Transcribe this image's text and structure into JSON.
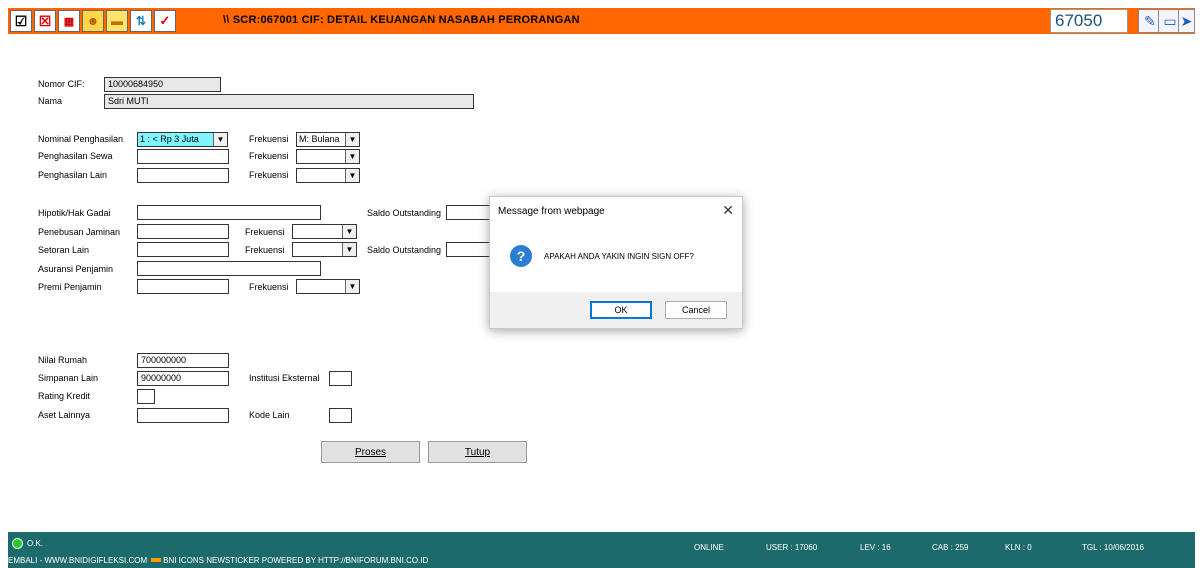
{
  "header": {
    "title": "\\\\ SCR:067001 CIF: DETAIL KEUANGAN NASABAH PERORANGAN",
    "code": "67050",
    "icons_left": [
      "checkbox-icon",
      "close-red-icon",
      "calendar-icon",
      "people-icon",
      "card-icon",
      "tree-icon",
      "chart-icon"
    ],
    "icons_right": [
      "pen-icon",
      "window-icon",
      "arrow-icon"
    ]
  },
  "form": {
    "nomor_cif": {
      "label": "Nomor CIF:",
      "value": "10000684950"
    },
    "nama": {
      "label": "Nama",
      "value": "Sdri MUTI"
    },
    "nominal_penghasilan": {
      "label": "Nominal Penghasilan",
      "value": "1 : < Rp 3 Juta"
    },
    "frekuensi_1": {
      "label": "Frekuensi",
      "value": "M: Bulana"
    },
    "penghasilan_sewa": {
      "label": "Penghasilan Sewa",
      "value": ""
    },
    "frekuensi_2": {
      "label": "Frekuensi",
      "value": ""
    },
    "penghasilan_lain": {
      "label": "Penghasilan Lain",
      "value": ""
    },
    "frekuensi_3": {
      "label": "Frekuensi",
      "value": ""
    },
    "hipotik": {
      "label": "Hipotik/Hak Gadai",
      "value": ""
    },
    "saldo_outstanding_1": {
      "label": "Saldo Outstanding",
      "value": ""
    },
    "penebusan_jaminan": {
      "label": "Penebusan Jaminan",
      "value": ""
    },
    "frekuensi_4": {
      "label": "Frekuensi",
      "value": ""
    },
    "setoran_lain": {
      "label": "Setoran Lain",
      "value": ""
    },
    "frekuensi_5": {
      "label": "Frekuensi",
      "value": ""
    },
    "saldo_outstanding_2": {
      "label": "Saldo Outstanding",
      "value": ""
    },
    "asuransi_penjamin": {
      "label": "Asuransi Penjamin",
      "value": ""
    },
    "premi_penjamin": {
      "label": "Premi Penjamin",
      "value": ""
    },
    "frekuensi_6": {
      "label": "Frekuensi",
      "value": ""
    },
    "nilai_rumah": {
      "label": "Nilai Rumah",
      "value": "700000000"
    },
    "simpanan_lain": {
      "label": "Simpanan Lain",
      "value": "90000000"
    },
    "institusi_eksternal": {
      "label": "Institusi Eksternal",
      "value": ""
    },
    "rating_kredit": {
      "label": "Rating Kredit",
      "value": ""
    },
    "aset_lainnya": {
      "label": "Aset Lainnya",
      "value": ""
    },
    "kode_lain": {
      "label": "Kode Lain",
      "value": ""
    },
    "proses_label": "Proses",
    "tutup_label": "Tutup"
  },
  "dialog": {
    "title": "Message from webpage",
    "message": "APAKAH ANDA YAKIN INGIN SIGN OFF?",
    "ok_label": "OK",
    "cancel_label": "Cancel"
  },
  "statusbar": {
    "ok_text": "O.K.",
    "online": "ONLINE",
    "user": "USER : 17060",
    "lev": "LEV : 16",
    "cab": "CAB : 259",
    "kln": "KLN : 0",
    "tgl": "TGL : 10/06/2016",
    "ticker_left": "EMBALI - WWW.BNIDIGIFLEKSI.COM",
    "ticker_right": "BNI ICONS NEWSTICKER POWERED BY HTTP://BNIFORUM.BNI.CO.ID"
  },
  "colors": {
    "topbar": "#ff6600",
    "statusbar": "#1d6a6a",
    "field_highlight": "#7ff5ff",
    "dialog_icon": "#2b7cd3"
  }
}
